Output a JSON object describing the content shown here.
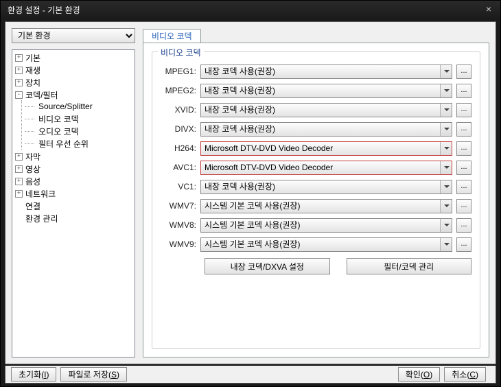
{
  "window": {
    "title": "환경 설정 - 기본 환경"
  },
  "selector": {
    "value": "기본 환경"
  },
  "tree": {
    "items": [
      {
        "label": "기본",
        "exp": "+"
      },
      {
        "label": "재생",
        "exp": "+"
      },
      {
        "label": "장치",
        "exp": "+"
      },
      {
        "label": "코덱/필터",
        "exp": "-",
        "children": [
          {
            "label": "Source/Splitter"
          },
          {
            "label": "비디오 코덱"
          },
          {
            "label": "오디오 코덱"
          },
          {
            "label": "필터 우선 순위"
          }
        ]
      },
      {
        "label": "자막",
        "exp": "+"
      },
      {
        "label": "영상",
        "exp": "+"
      },
      {
        "label": "음성",
        "exp": "+"
      },
      {
        "label": "네트워크",
        "exp": "+"
      },
      {
        "label": "연결",
        "exp": ""
      },
      {
        "label": "환경 관리",
        "exp": ""
      }
    ]
  },
  "tab": {
    "label": "비디오 코덱"
  },
  "group": {
    "title": "비디오 코덱"
  },
  "codecs": [
    {
      "label": "MPEG1:",
      "value": "내장 코덱 사용(권장)",
      "hl": false
    },
    {
      "label": "MPEG2:",
      "value": "내장 코덱 사용(권장)",
      "hl": false
    },
    {
      "label": "XVID:",
      "value": "내장 코덱 사용(권장)",
      "hl": false
    },
    {
      "label": "DIVX:",
      "value": "내장 코덱 사용(권장)",
      "hl": false
    },
    {
      "label": "H264:",
      "value": "Microsoft DTV-DVD Video Decoder",
      "hl": true
    },
    {
      "label": "AVC1:",
      "value": "Microsoft DTV-DVD Video Decoder",
      "hl": true
    },
    {
      "label": "VC1:",
      "value": "내장 코덱 사용(권장)",
      "hl": false
    },
    {
      "label": "WMV7:",
      "value": "시스템 기본 코덱 사용(권장)",
      "hl": false
    },
    {
      "label": "WMV8:",
      "value": "시스템 기본 코덱 사용(권장)",
      "hl": false
    },
    {
      "label": "WMV9:",
      "value": "시스템 기본 코덱 사용(권장)",
      "hl": false
    }
  ],
  "more_label": "...",
  "buttons": {
    "dxva": "내장 코덱/DXVA 설정",
    "filter": "필터/코덱 관리"
  },
  "footer": {
    "reset": "초기화",
    "reset_k": "I",
    "save": "파일로 저장",
    "save_k": "S",
    "ok": "확인",
    "ok_k": "O",
    "cancel": "취소",
    "cancel_k": "C"
  }
}
